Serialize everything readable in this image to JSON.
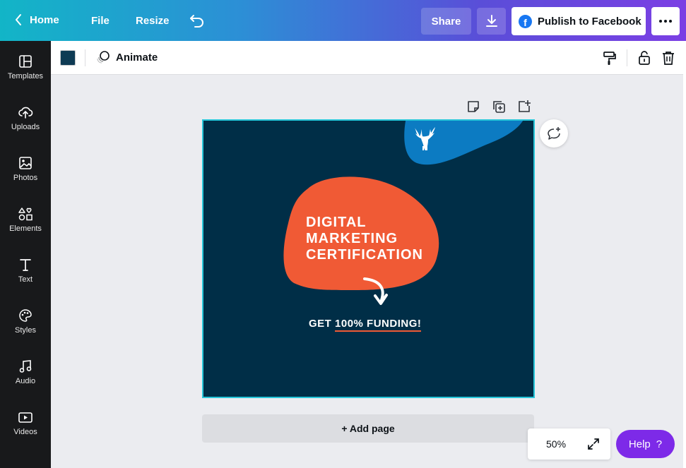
{
  "topbar": {
    "home": "Home",
    "file": "File",
    "resize": "Resize",
    "share": "Share",
    "publish": "Publish to Facebook",
    "fb_letter": "f"
  },
  "sidebar": {
    "items": [
      {
        "label": "Templates",
        "icon": "templates-icon"
      },
      {
        "label": "Uploads",
        "icon": "upload-cloud-icon"
      },
      {
        "label": "Photos",
        "icon": "image-icon"
      },
      {
        "label": "Elements",
        "icon": "shapes-icon"
      },
      {
        "label": "Text",
        "icon": "text-t-icon"
      },
      {
        "label": "Styles",
        "icon": "palette-icon"
      },
      {
        "label": "Audio",
        "icon": "music-note-icon"
      },
      {
        "label": "Videos",
        "icon": "video-icon"
      }
    ]
  },
  "subbar": {
    "swatch_color": "#0e3b54",
    "animate": "Animate"
  },
  "design": {
    "headline": [
      "DIGITAL",
      "MARKETING",
      "CERTIFICATION"
    ],
    "funding_prefix": "GET ",
    "funding_underlined": "100% FUNDING!",
    "bg_color": "#002e47",
    "blob_color": "#f05a35",
    "corner_blob_color": "#0c7bc2"
  },
  "canvas": {
    "add_page": "+ Add page"
  },
  "zoom": {
    "value": "50%"
  },
  "help": {
    "label": "Help",
    "glyph": "?"
  }
}
